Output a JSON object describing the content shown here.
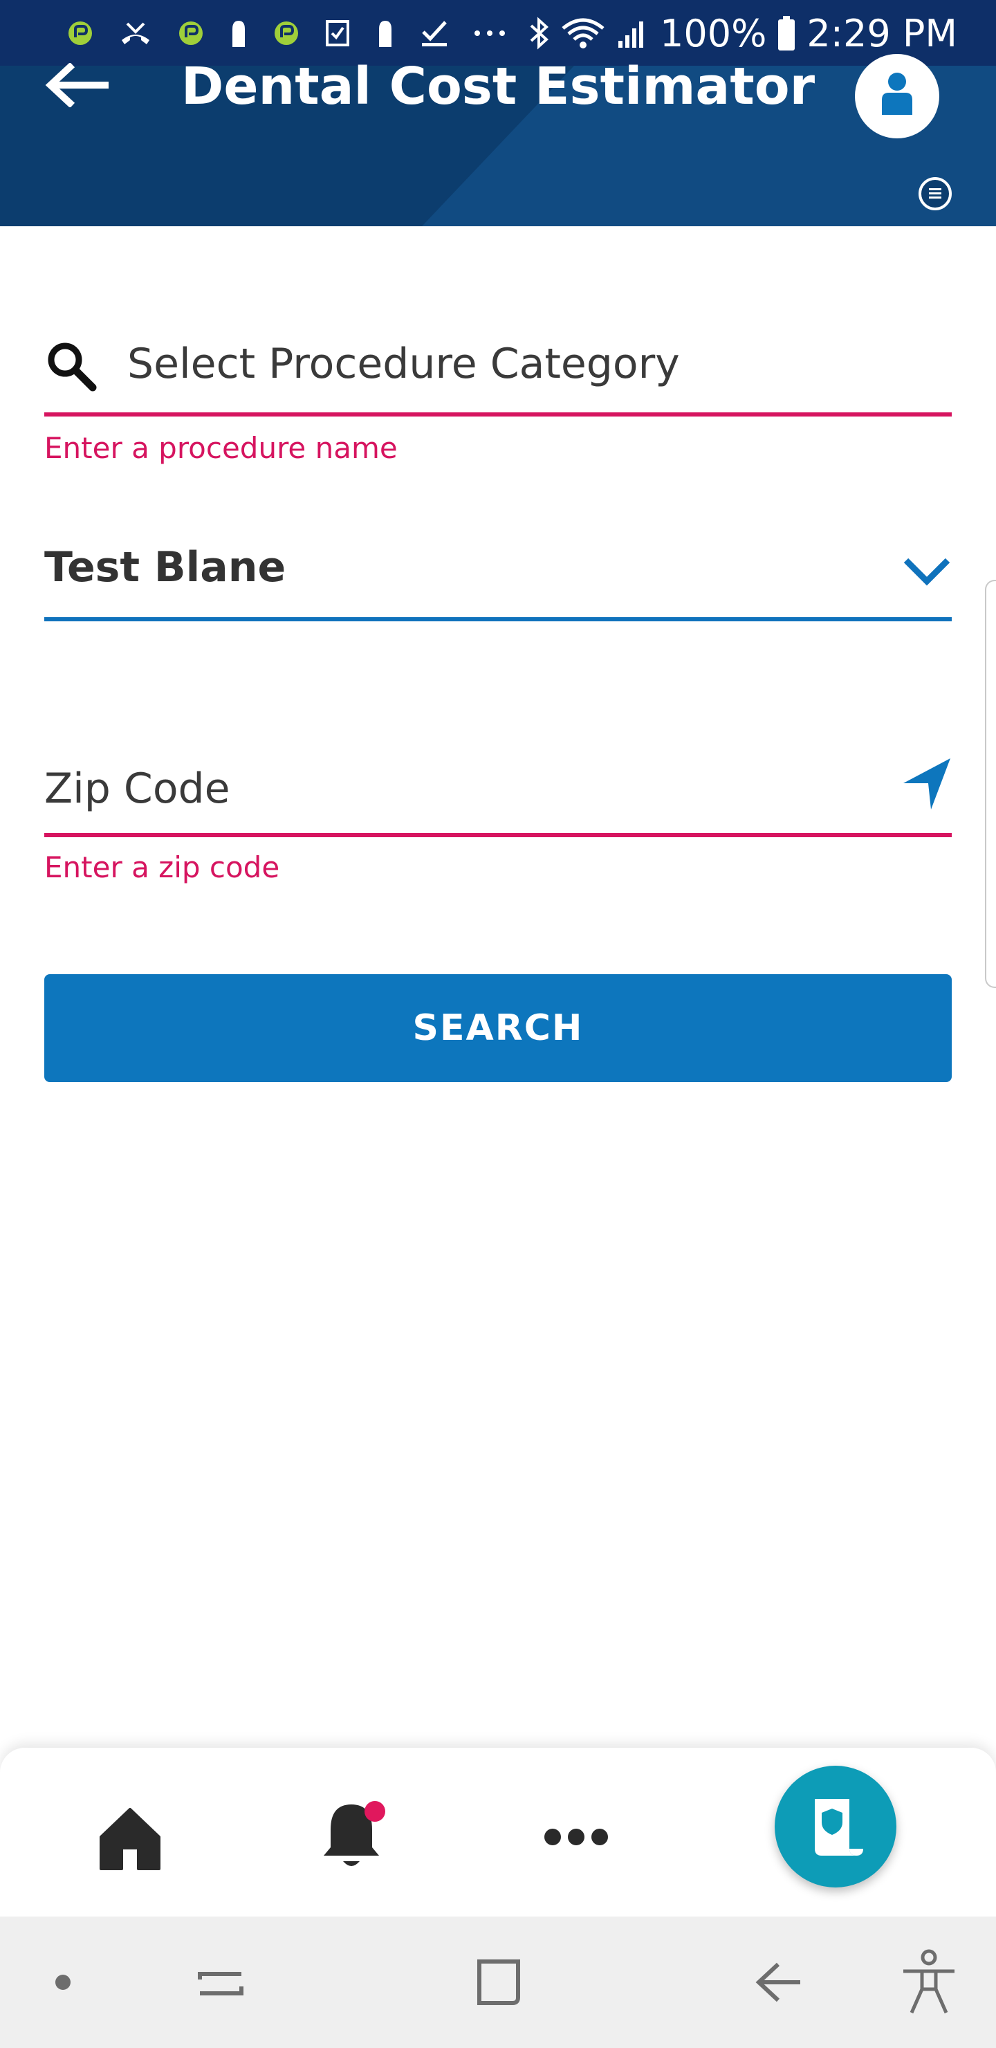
{
  "status_bar": {
    "battery": "100%",
    "time": "2:29 PM",
    "icons": [
      "app-notification-icon",
      "missed-call-icon",
      "app-notification-icon",
      "tag-icon",
      "app-notification-icon",
      "checkbox-icon",
      "tag-icon",
      "check-icon",
      "more-notifications-icon",
      "bluetooth-icon",
      "wifi-icon",
      "signal-icon",
      "battery-icon"
    ]
  },
  "header": {
    "title": "Dental Cost Estimator",
    "back_icon": "arrow-left-icon",
    "profile_icon": "user-avatar-icon"
  },
  "form": {
    "procedure": {
      "placeholder": "Select Procedure Category",
      "error": "Enter a procedure name"
    },
    "plan": {
      "selected": "Test Blane"
    },
    "zip": {
      "placeholder": "Zip Code",
      "error": "Enter a zip code"
    },
    "search_label": "SEARCH"
  },
  "bottom_nav": {
    "items": [
      {
        "icon": "home-icon"
      },
      {
        "icon": "bell-icon",
        "has_badge": true
      },
      {
        "icon": "more-icon"
      }
    ],
    "fab_icon": "shield-document-icon"
  },
  "colors": {
    "status_bar": "#0e2f68",
    "header": "#0c3d6e",
    "error": "#d6145f",
    "primary": "#0d76bd",
    "fab": "#0d9cb7"
  }
}
